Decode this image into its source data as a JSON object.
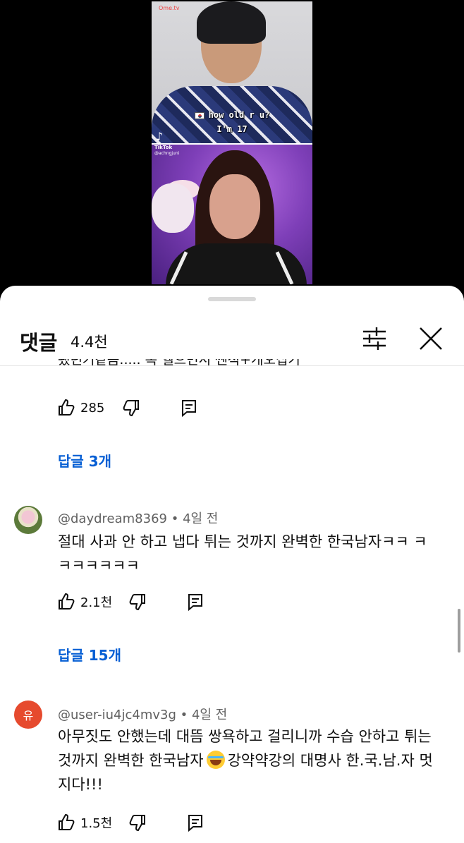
{
  "video": {
    "top_watermark": "Ome.tv",
    "caption_line1": "how old r u?",
    "caption_line2": "I'm 17",
    "tiktok_label": "TikTok",
    "tiktok_user": "@achngjuni"
  },
  "comments_sheet": {
    "title": "댓글",
    "count": "4.4천",
    "truncated_text": "됐던거같음..... 폭 헬으면서 쎈척+개오집기",
    "first_thread": {
      "likes": "285",
      "replies_label": "답글 3개"
    },
    "comments": [
      {
        "author": "@daydream8369",
        "time": "4일 전",
        "avatar_letter": "",
        "text": "절대 사과 안 하고 냅다 튀는 것까지 완벽한 한국남자ㅋㅋ ㅋㅋㅋㅋㅋㅋㅋ",
        "likes": "2.1천",
        "replies_label": "답글 15개"
      },
      {
        "author": "@user-iu4jc4mv3g",
        "time": "4일 전",
        "avatar_letter": "유",
        "text_before_emoji": "아무짓도 안했는데 대뜸 쌍욕하고 걸리니까 수습 안하고 튀는것까지 완벽한 한국남자",
        "emoji": "face-with-tears-of-joy",
        "text_after_emoji": "강약약강의 대명사 한.국.남.자 멋지다!!!",
        "likes": "1.5천"
      }
    ]
  },
  "colors": {
    "link_blue": "#065fd4",
    "avatar_orange": "#e64a2e",
    "text_primary": "#0f0f0f",
    "text_secondary": "#606060"
  }
}
